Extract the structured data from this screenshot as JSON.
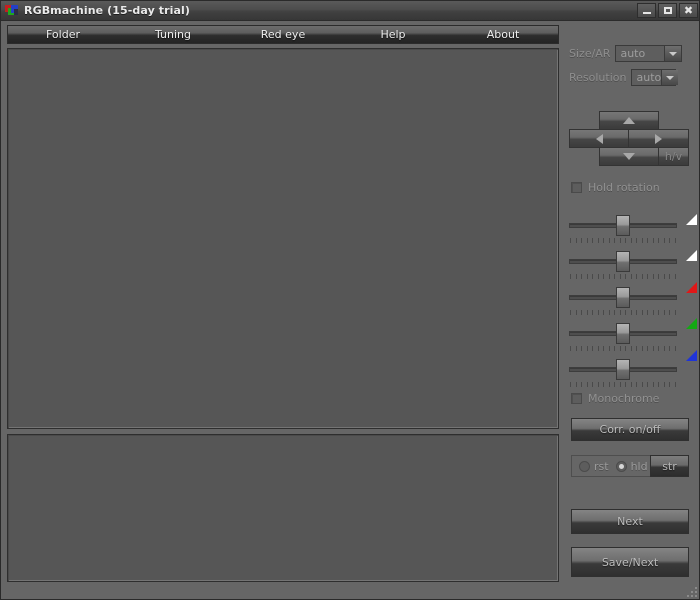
{
  "window": {
    "title": "RGBmachine (15-day trial)",
    "icon": "rgb-logo-icon",
    "buttons": {
      "minimize": "minimize-icon",
      "maximize": "maximize-icon",
      "close": "close-icon"
    }
  },
  "menubar": {
    "items": [
      {
        "label": "Folder"
      },
      {
        "label": "Tuning"
      },
      {
        "label": "Red eye"
      },
      {
        "label": "Help"
      },
      {
        "label": "About"
      }
    ]
  },
  "panels": {
    "main_preview": "",
    "secondary_preview": ""
  },
  "sidebar": {
    "size_ar": {
      "label": "Size/AR",
      "value": "auto",
      "options": [
        "auto"
      ]
    },
    "resolution": {
      "label": "Resolution",
      "value": "auto",
      "options": [
        "auto"
      ]
    },
    "rotation": {
      "up": "arrow-up-icon",
      "left": "arrow-left-icon",
      "right": "arrow-right-icon",
      "down": "arrow-down-icon",
      "hv_label": "h/v"
    },
    "hold_rotation": {
      "label": "Hold rotation",
      "checked": false
    },
    "sliders": [
      {
        "name": "brightness",
        "value": 50,
        "marker_color": "#ffffff"
      },
      {
        "name": "contrast",
        "value": 50,
        "marker_color": "#ffffff"
      },
      {
        "name": "red",
        "value": 50,
        "marker_color": "#e01818"
      },
      {
        "name": "green",
        "value": 50,
        "marker_color": "#14a814"
      },
      {
        "name": "blue",
        "value": 50,
        "marker_color": "#1f34d8"
      }
    ],
    "monochrome": {
      "label": "Monochrome",
      "checked": false
    },
    "corr_button": {
      "label": "Corr. on/off"
    },
    "mode_group": {
      "options": [
        {
          "label": "rst",
          "selected": false
        },
        {
          "label": "hld",
          "selected": true
        }
      ],
      "str_label": "str"
    },
    "next_button": {
      "label": "Next"
    },
    "save_next_button": {
      "label": "Save/Next"
    }
  }
}
